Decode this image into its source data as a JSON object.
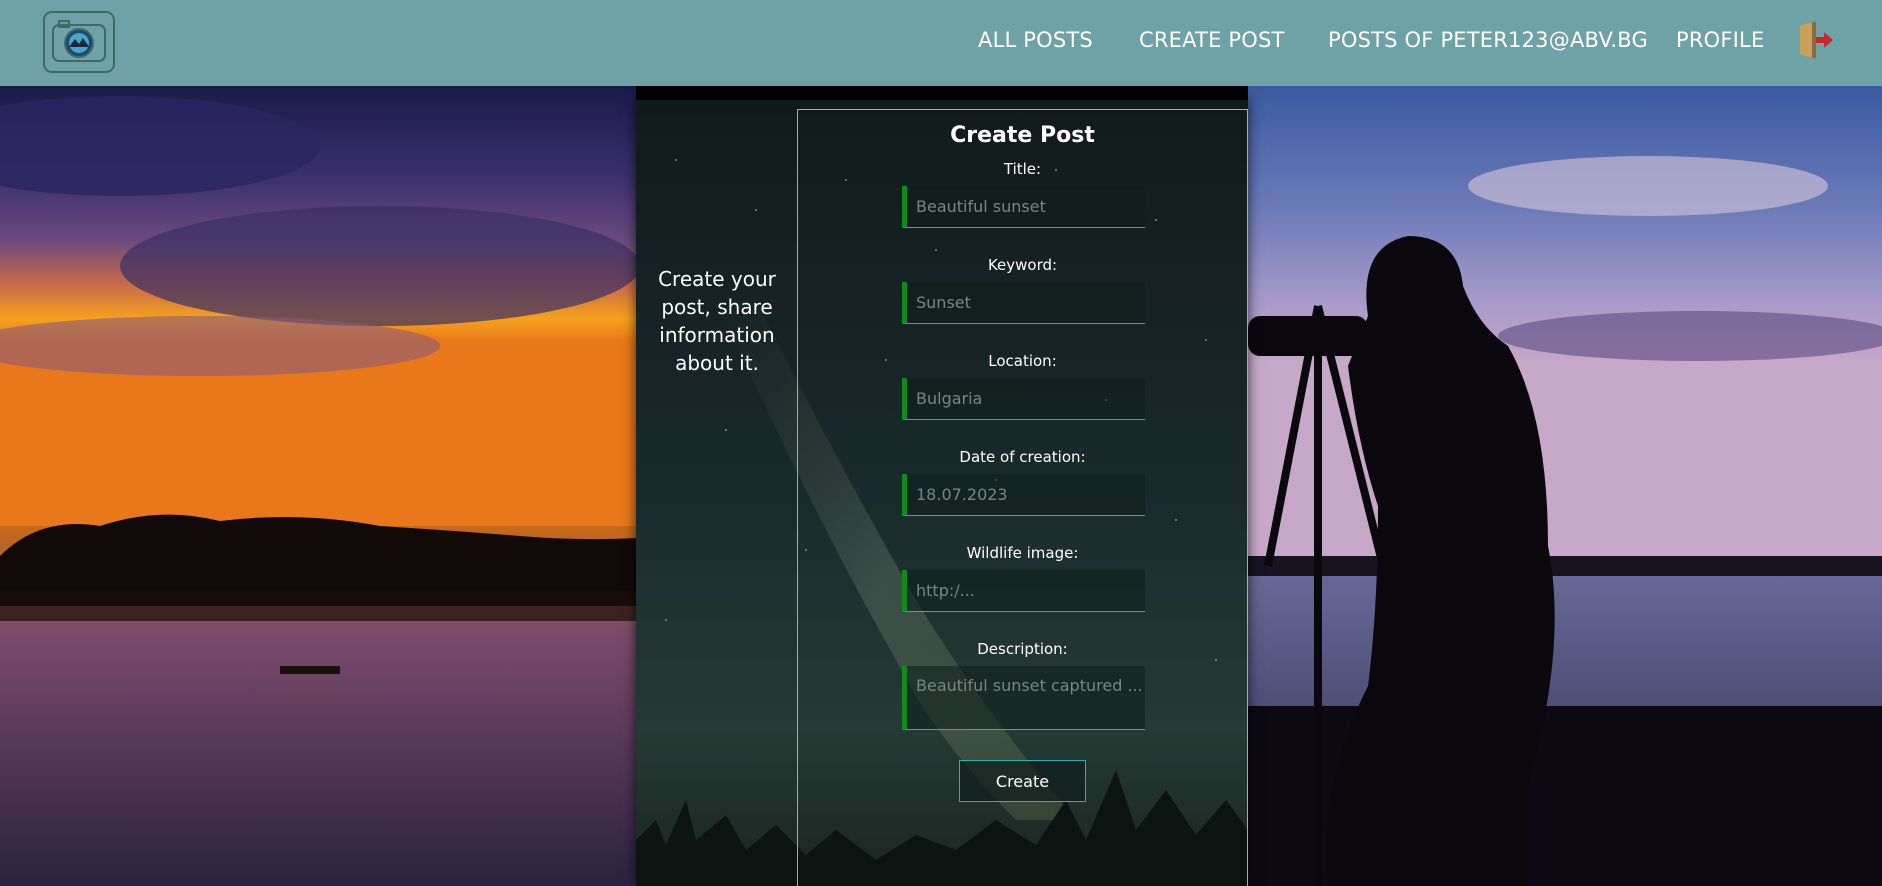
{
  "nav": {
    "logo_icon": "camera-logo-icon",
    "links": [
      "ALL POSTS",
      "CREATE POST",
      "POSTS OF PETER123@ABV.BG",
      "PROFILE"
    ],
    "logout_icon": "logout-door-icon"
  },
  "side_text": "Create your post, share information about it.",
  "form": {
    "title": "Create Post",
    "fields": [
      {
        "label": "Title:",
        "placeholder": "Beautiful sunset"
      },
      {
        "label": "Keyword:",
        "placeholder": "Sunset"
      },
      {
        "label": "Location:",
        "placeholder": "Bulgaria"
      },
      {
        "label": "Date of creation:",
        "placeholder": "18.07.2023"
      },
      {
        "label": "Wildlife image:",
        "placeholder": "http:/..."
      },
      {
        "label": "Description:",
        "placeholder": "Beautiful sunset captured ..."
      }
    ],
    "submit_label": "Create"
  },
  "colors": {
    "nav_bg": "#6fa2a6",
    "input_accent": "#0f8a1e",
    "input_underline": "#24b3b0"
  }
}
